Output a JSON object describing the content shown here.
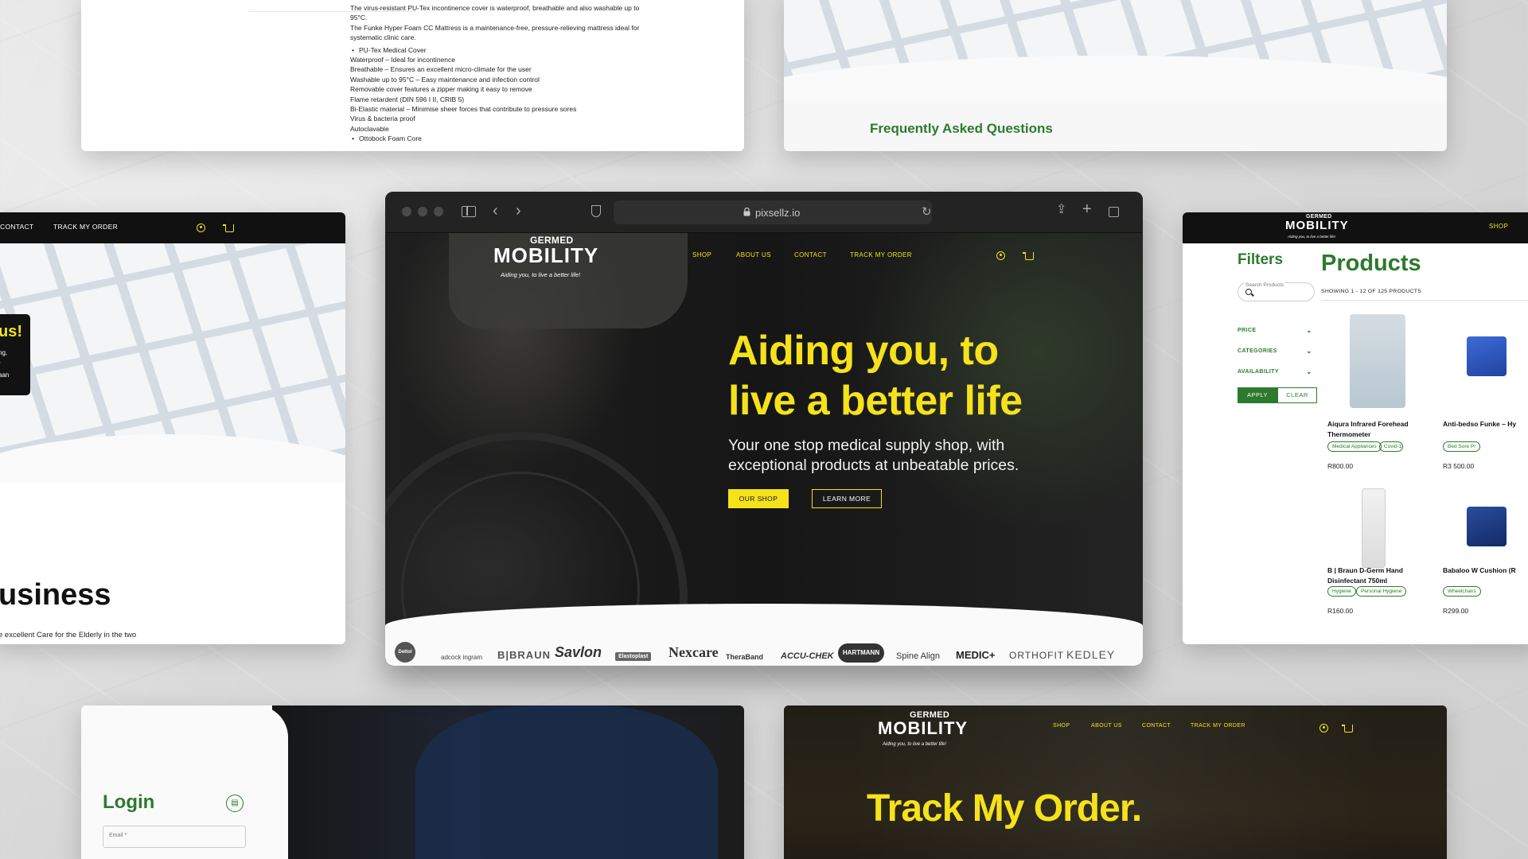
{
  "browser": {
    "url": "pixsellz.io",
    "nav": [
      "SHOP",
      "ABOUT US",
      "CONTACT",
      "TRACK MY ORDER"
    ],
    "logo": {
      "top": "GERMED",
      "main": "MOBILITY",
      "tagline": "Aiding you, to live a better life!"
    },
    "hero_title_line1": "Aiding you, to",
    "hero_title_line2": "live a better life",
    "hero_subtitle": "Your one stop medical supply shop, with exceptional products at unbeatable prices.",
    "btn_shop": "OUR SHOP",
    "btn_more": "LEARN MORE",
    "brands": [
      "Dettol",
      "adcock ingram",
      "B|BRAUN",
      "Savlon",
      "Elastoplast",
      "Nexcare",
      "TheraBand",
      "ACCU-CHEK",
      "HARTMANN",
      "Spine Align",
      "MEDIC+",
      "ORTHOFIT",
      "KEDLEY"
    ]
  },
  "doc": {
    "lines": [
      "The virus-resistant PU-Tex incontinence cover is waterproof, breathable and also washable up to 95°C.",
      "The Funke Hyper Foam CC Mattress is a maintenance-free, pressure-relieving mattress ideal for systematic clinic care."
    ],
    "bullet1": "PU-Tex Medical Cover",
    "features": [
      "Waterproof – Ideal for incontinence",
      "Breathable – Ensures an excellent micro-climate for the user",
      "Washable up to 95°C – Easy maintenance and infection control",
      "Removable cover features a zipper making it easy to remove",
      "Flame retardent (DIN 596 I II, CRIB 5)",
      "Bi-Elastic material – Minimise sheer forces that contribute to pressure sores",
      "Virus & bacteria proof",
      "Autoclavable"
    ],
    "bullet2": "Ottobock Foam Core"
  },
  "faq": {
    "title": "Frequently Asked Questions"
  },
  "left_page": {
    "nav": [
      "CONTACT",
      "TRACK MY ORDER"
    ],
    "us_title": "us!",
    "us_lines": [
      "ng,",
      "r",
      "aan"
    ],
    "biz_title": "usiness",
    "biz_text": "e excellent Care for the Elderly in the two"
  },
  "products_page": {
    "nav_shop": "SHOP",
    "filters_title": "Filters",
    "products_title": "Products",
    "search_placeholder": "Search Products",
    "showing": "SHOWING 1 - 12 OF 125 PRODUCTS",
    "filters": [
      "PRICE",
      "CATEGORIES",
      "AVAILABILITY"
    ],
    "apply": "APPLY",
    "clear": "CLEAR",
    "items": [
      {
        "name": "Aiqura Infrared Forehead Thermometer",
        "tags": [
          "Medical Appliances",
          "Covid-1"
        ],
        "price": "R800.00"
      },
      {
        "name": "Anti-bedso Funke – Hy",
        "tags": [
          "Bed Sore Pr"
        ],
        "price": "R3 500.00"
      },
      {
        "name": "B | Braun D-Germ Hand Disinfectant 750ml",
        "tags": [
          "Hygiene",
          "Personal Hygiene"
        ],
        "price": "R160.00"
      },
      {
        "name": "Babaloo W Cushion (R",
        "tags": [
          "Wheelchairs"
        ],
        "price": "R299.00"
      }
    ]
  },
  "login_page": {
    "title": "Login",
    "email_placeholder": "Email *"
  },
  "track_page": {
    "nav": [
      "SHOP",
      "ABOUT US",
      "CONTACT",
      "TRACK MY ORDER"
    ],
    "title": "Track My Order."
  },
  "colors": {
    "brand_green": "#2d7a2e",
    "brand_yellow": "#f5e21b",
    "dark": "#111111"
  }
}
